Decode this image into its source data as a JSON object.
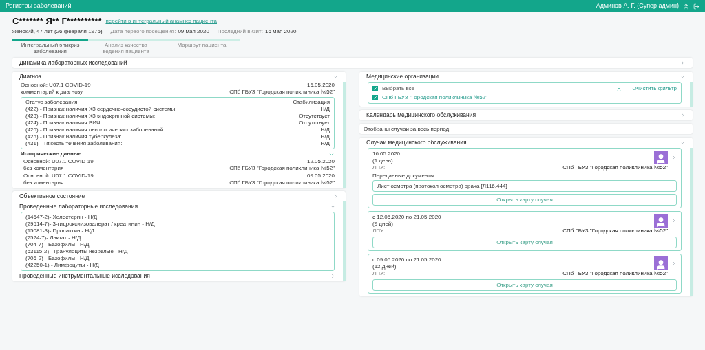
{
  "header": {
    "title": "Регистры заболеваний",
    "user": "Админов А. Г. (Супер админ)"
  },
  "patient": {
    "name": "С******* Я** Г**********",
    "link": "перейти в интегральный анамнез пациента",
    "info": "женский, 47 лет (26 февраля 1975)",
    "first_visit_label": "Дата первого посещения:",
    "first_visit": "09 мая 2020",
    "last_visit_label": "Последний визит:",
    "last_visit": "16 мая 2020"
  },
  "tabs": [
    {
      "label": "Интегральный эпикриз заболевания",
      "selected": true
    },
    {
      "label": "Анализ качества ведения пациента",
      "selected": false
    },
    {
      "label": "Маршрут пациента",
      "selected": false
    }
  ],
  "lab_dynamics": {
    "title": "Динамика лабораторных исследований",
    "expanded": false
  },
  "diagnosis": {
    "title": "Диагноз",
    "expanded": true,
    "main": "Основной: U07.1 COVID-19",
    "comment": "комментарий к диагнозу",
    "date": "16.05.2020",
    "org": "СПб ГБУЗ \"Городская поликлиника №52\"",
    "signs": [
      {
        "label": "Статус заболевания:",
        "value": "Стабилизация"
      },
      {
        "label": "(422) - Признак наличия ХЗ сердечно-сосудистой системы:",
        "value": "Н/Д"
      },
      {
        "label": "(423) - Признак наличия ХЗ эндокринной системы:",
        "value": "Отсутствует"
      },
      {
        "label": "(424) - Признак наличия ВИЧ:",
        "value": "Отсутствует"
      },
      {
        "label": "(426) - Признак наличия онкологических заболеваний:",
        "value": "Н/Д"
      },
      {
        "label": "(425) - Признак наличия туберкулеза:",
        "value": "Н/Д"
      },
      {
        "label": "(431) - Тяжесть течения заболевания:",
        "value": "Н/Д"
      }
    ],
    "history_title": "Исторические данные:",
    "history_expanded": true,
    "history": [
      {
        "main": "Основной: U07.1 COVID-19",
        "comment": "без коментария",
        "date": "12.05.2020",
        "org": "СПб ГБУЗ \"Городская поликлиника №52\""
      },
      {
        "main": "Основной: U07.1 COVID-19",
        "comment": "без коментария",
        "date": "09.05.2020",
        "org": "СПб ГБУЗ \"Городская поликлиника №52\""
      }
    ]
  },
  "objective": {
    "title": "Объективное состояние",
    "expanded": false
  },
  "lab_tests": {
    "title": "Проведенные лабораторные исследования",
    "expanded": true,
    "items": [
      "(14647-2)- Холестерин - Н/Д",
      "(29514-7)- 3-гидроксиизовалерат / креатинин - Н/Д",
      "(15081-3)- Пролактин - Н/Д",
      "(2524-7)- Лактат - Н/Д",
      "(704-7) - Базофилы - Н/Д",
      "(53115-2) - Гранулоциты незрелые - Н/Д",
      "(706-2) - Базофилы - Н/Д",
      "(42250-1) - Лимфоциты - Н/Д"
    ]
  },
  "instrumental": {
    "title": "Проведенные инструментальные исследования",
    "expanded": false
  },
  "med_orgs": {
    "title": "Медицинские организации",
    "expanded": true,
    "select_all": {
      "label": "Выбрать все",
      "checked": true
    },
    "clear": "Очистить фильтр",
    "orgs": [
      {
        "label": "СПб ГБУЗ \"Городская поликлиника №52\"",
        "checked": true
      }
    ]
  },
  "calendar": {
    "title": "Календарь медицинского обслуживания",
    "expanded": false
  },
  "filter_note": "Отобраны случаи за весь период",
  "cases": {
    "title": "Случаи медицинского обслуживания",
    "expanded": true,
    "items": [
      {
        "period": "16.05.2020",
        "duration": "(1 день)",
        "lpu_label": "ЛПУ:",
        "lpu": "СПб ГБУЗ \"Городская поликлиника №52\"",
        "docs_title": "Переданные документы:",
        "docs": [
          "Лист осмотра (протокол осмотра) врача [Л116.444]"
        ],
        "button": "Открыть карту случая"
      },
      {
        "period": "с 12.05.2020 по 21.05.2020",
        "duration": "(9 дней)",
        "lpu_label": "ЛПУ:",
        "lpu": "СПб ГБУЗ \"Городская поликлиника №52\"",
        "button": "Открыть карту случая"
      },
      {
        "period": "с 09.05.2020 по 21.05.2020",
        "duration": "(12 дней)",
        "lpu_label": "ЛПУ:",
        "lpu": "СПб ГБУЗ \"Городская поликлиника №52\"",
        "button": "Открыть карту случая"
      }
    ]
  }
}
